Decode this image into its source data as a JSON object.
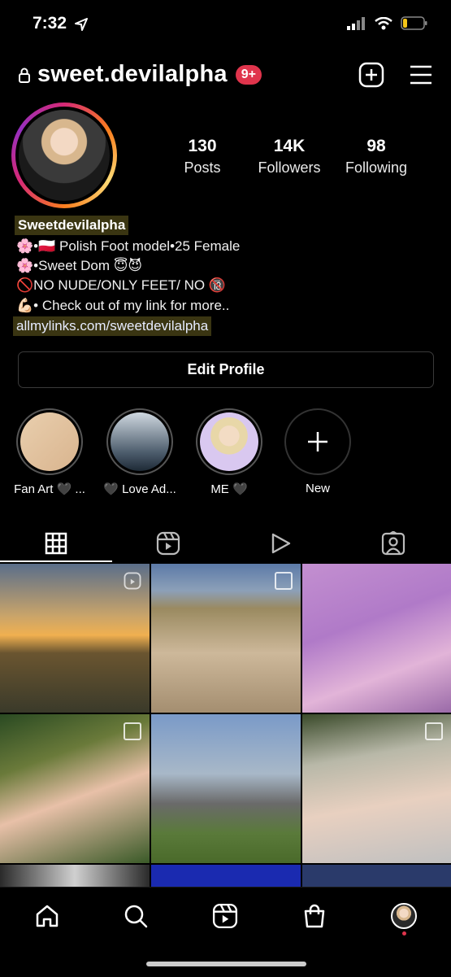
{
  "status_bar": {
    "time": "7:32"
  },
  "header": {
    "username": "sweet.devilalpha",
    "notification_count": "9+"
  },
  "profile": {
    "stats": [
      {
        "value": "130",
        "label": "Posts"
      },
      {
        "value": "14K",
        "label": "Followers"
      },
      {
        "value": "98",
        "label": "Following"
      }
    ],
    "display_name": "Sweetdevilalpha",
    "bio_lines": [
      "🌸•🇵🇱 Polish Foot model•25 Female",
      "🌸•Sweet Dom 😇😈",
      "🚫NO NUDE/ONLY FEET/ NO 🔞",
      "💪🏻• Check out of my link for more.."
    ],
    "link": "allmylinks.com/sweetdevilalpha",
    "edit_button": "Edit Profile"
  },
  "highlights": [
    {
      "label": "Fan Art 🖤 ..."
    },
    {
      "label": "🖤 Love Ad..."
    },
    {
      "label": "ME 🖤"
    },
    {
      "label": "New"
    }
  ],
  "tabs": [
    "grid-icon",
    "reels-icon",
    "video-icon",
    "tagged-icon"
  ],
  "colors": {
    "accent_badge": "#e0344c",
    "link_highlight": "#3a3512"
  }
}
